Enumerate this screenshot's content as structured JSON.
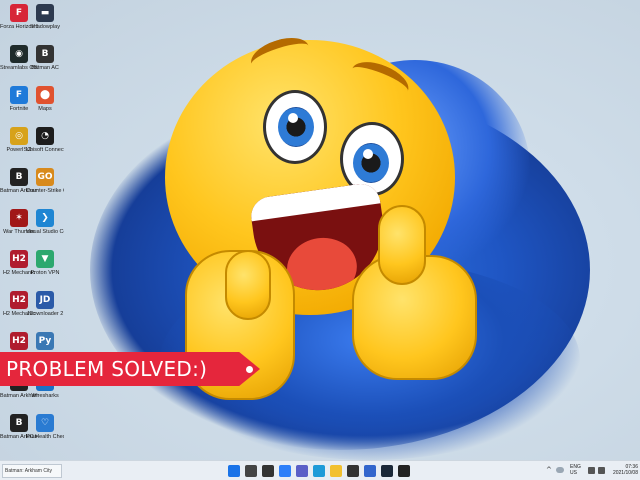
{
  "desktop_icons": [
    {
      "label": "Forza Horizon 5",
      "color": "#d72638",
      "sym": "F"
    },
    {
      "label": "Shadowplay",
      "color": "#2d3a4f",
      "sym": "▬"
    },
    {
      "label": "Streamlabs OBS",
      "color": "#1f2b2b",
      "sym": "◉"
    },
    {
      "label": "Batman AC",
      "color": "#333333",
      "sym": "B"
    },
    {
      "label": "Fortnite",
      "color": "#1f7ad9",
      "sym": "F"
    },
    {
      "label": "Maps",
      "color": "#e0522f",
      "sym": "⬤"
    },
    {
      "label": "PowerISO",
      "color": "#d7a21a",
      "sym": "◎"
    },
    {
      "label": "Ubisoft Connect",
      "color": "#1d1d1d",
      "sym": "◔"
    },
    {
      "label": "Batman Arkham Ori...",
      "color": "#222222",
      "sym": "B"
    },
    {
      "label": "Counter-Strike Global Offe...",
      "color": "#d88a1c",
      "sym": "GO"
    },
    {
      "label": "War Thunder",
      "color": "#a11818",
      "sym": "✶"
    },
    {
      "label": "Visual Studio Code",
      "color": "#1f86d3",
      "sym": "❯"
    },
    {
      "label": "H2 Mechanic",
      "color": "#b01c2e",
      "sym": "H2"
    },
    {
      "label": "Proton VPN",
      "color": "#2ca86e",
      "sym": "▼"
    },
    {
      "label": "H2 Mechanic",
      "color": "#b01c2e",
      "sym": "H2"
    },
    {
      "label": "JDownloader 2",
      "color": "#2b5aa8",
      "sym": "JD"
    },
    {
      "label": "H2 Mechanic",
      "color": "#b01c2e",
      "sym": "H2"
    },
    {
      "label": "Python",
      "color": "#3a78b4",
      "sym": "Py"
    },
    {
      "label": "Batman Arkham City",
      "color": "#222222",
      "sym": "B"
    },
    {
      "label": "Wiresharks",
      "color": "#1b72c6",
      "sym": "≈"
    },
    {
      "label": "Batman Arkham City Village",
      "color": "#222222",
      "sym": "B"
    },
    {
      "label": "PC Health Check",
      "color": "#2a7bd2",
      "sym": "♡"
    }
  ],
  "banner": {
    "text": "PROBLEM SOLVED:)"
  },
  "taskbar": {
    "window_title": "Batman: Arkham City",
    "apps": [
      {
        "name": "start-button",
        "color": "#1a73e8"
      },
      {
        "name": "search-button",
        "color": "#444444"
      },
      {
        "name": "task-view-button",
        "color": "#333333"
      },
      {
        "name": "widgets-button",
        "color": "#2d7ff9"
      },
      {
        "name": "chat-button",
        "color": "#5b5fc7"
      },
      {
        "name": "edge-button",
        "color": "#1f9bd8"
      },
      {
        "name": "file-explorer-button",
        "color": "#f2c02f"
      },
      {
        "name": "store-button",
        "color": "#333333"
      },
      {
        "name": "mail-button",
        "color": "#3366cc"
      },
      {
        "name": "steam-button",
        "color": "#1b2838"
      },
      {
        "name": "batman-app-button",
        "color": "#222222"
      }
    ],
    "tray": {
      "lang": "ENG",
      "region": "US",
      "time": "07:36",
      "date": "2021/10/08"
    }
  }
}
